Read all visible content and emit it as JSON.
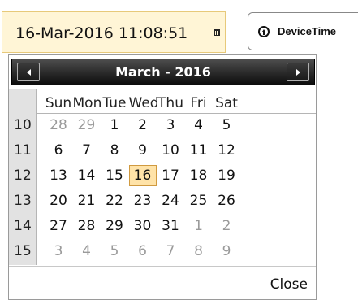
{
  "datetime_field": {
    "value": "16-Mar-2016 11:08:51",
    "picker_icon": "calendar-icon"
  },
  "device_time_button": {
    "label": "DeviceTime",
    "icon": "arrow-up-circle-icon"
  },
  "calendar": {
    "title": "March - 2016",
    "prev_icon": "caret-left-icon",
    "next_icon": "caret-right-icon",
    "day_headers": [
      "Sun",
      "Mon",
      "Tue",
      "Wed",
      "Thu",
      "Fri",
      "Sat"
    ],
    "weeks": [
      {
        "week": "10",
        "days": [
          "28",
          "29",
          "1",
          "2",
          "3",
          "4",
          "5"
        ]
      },
      {
        "week": "11",
        "days": [
          "6",
          "7",
          "8",
          "9",
          "10",
          "11",
          "12"
        ]
      },
      {
        "week": "12",
        "days": [
          "13",
          "14",
          "15",
          "16",
          "17",
          "18",
          "19"
        ]
      },
      {
        "week": "13",
        "days": [
          "20",
          "21",
          "22",
          "23",
          "24",
          "25",
          "26"
        ]
      },
      {
        "week": "14",
        "days": [
          "27",
          "28",
          "29",
          "30",
          "31",
          "1",
          "2"
        ]
      },
      {
        "week": "15",
        "days": [
          "3",
          "4",
          "5",
          "6",
          "7",
          "8",
          "9"
        ]
      }
    ],
    "selected_day": "16",
    "close_label": "Close"
  },
  "colors": {
    "input_background": "#fff5d6",
    "selected_day_background": "#ffe3a8",
    "header_background": "#1c1c1c",
    "other_month_text": "#9a9a9a"
  }
}
